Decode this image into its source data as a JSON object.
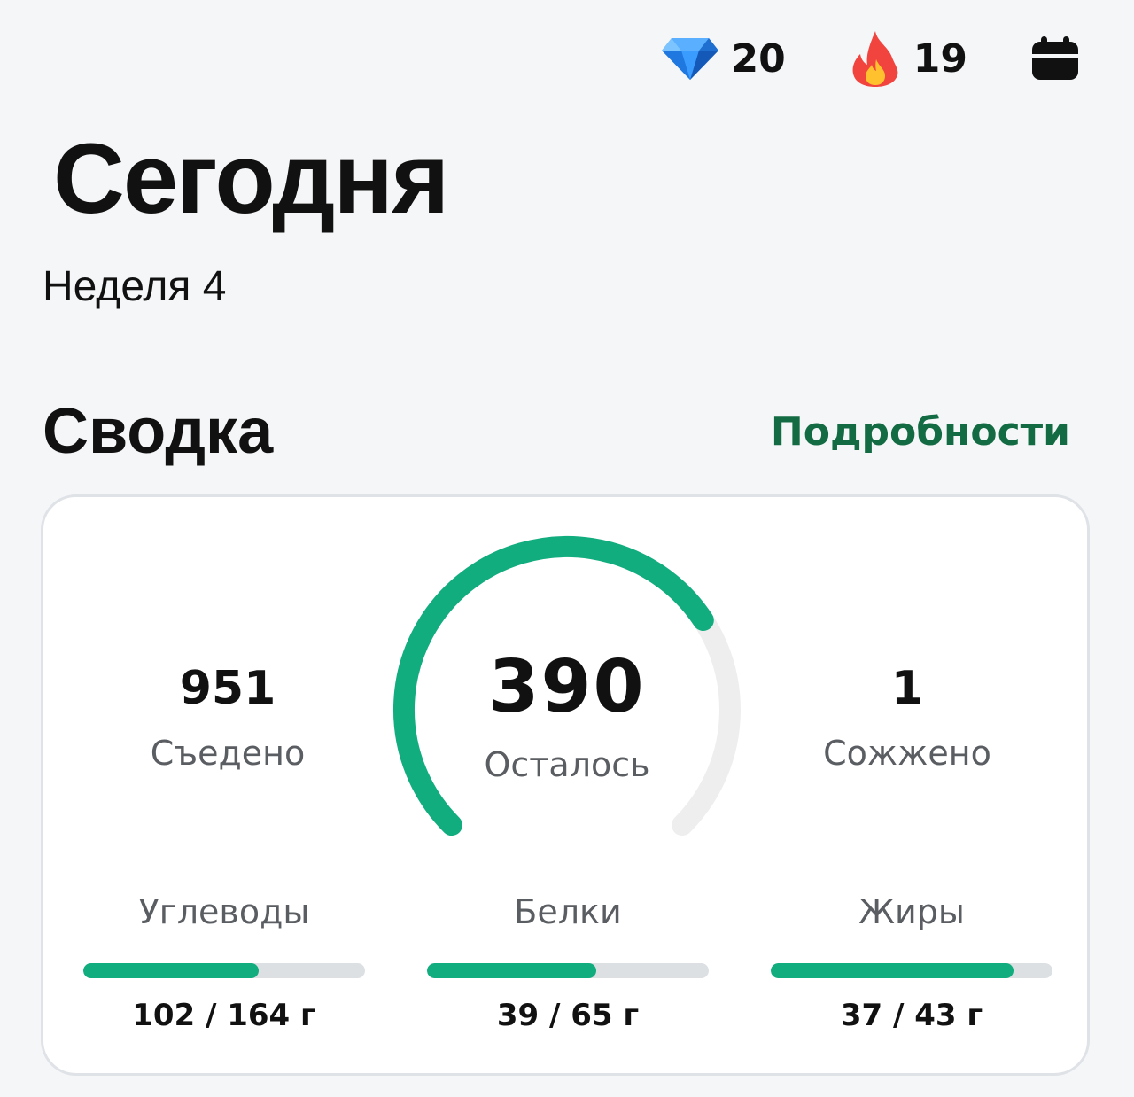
{
  "header": {
    "gems": {
      "icon": "diamond-icon",
      "value": "20"
    },
    "streak": {
      "icon": "fire-icon",
      "value": "19"
    },
    "calendar": {
      "icon": "calendar-icon"
    }
  },
  "page": {
    "title": "Сегодня",
    "subtitle": "Неделя 4"
  },
  "summary": {
    "title": "Сводка",
    "details_link": "Подробности",
    "eaten": {
      "value": "951",
      "label": "Съедено"
    },
    "remaining": {
      "value": "390",
      "label": "Осталось",
      "progress": 0.71
    },
    "burned": {
      "value": "1",
      "label": "Сожжено"
    },
    "macros": [
      {
        "label": "Углеводы",
        "value": "102 / 164 г",
        "current": 102,
        "goal": 164
      },
      {
        "label": "Белки",
        "value": "39 / 65 г",
        "current": 39,
        "goal": 65
      },
      {
        "label": "Жиры",
        "value": "37 / 43 г",
        "current": 37,
        "goal": 43
      }
    ]
  },
  "colors": {
    "accent": "#12ad7e",
    "link": "#136b43",
    "track": "#eeeeee"
  }
}
